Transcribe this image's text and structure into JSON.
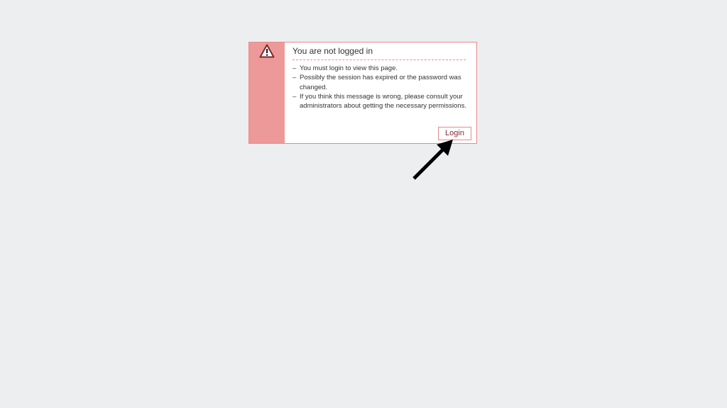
{
  "message": {
    "title": "You are not logged in",
    "items": [
      "You must login to view this page.",
      "Possibly the session has expired or the password was changed.",
      "If you think this message is wrong, please consult your administrators about getting the necessary permissions."
    ],
    "bullet": "–",
    "login_label": "Login",
    "icon": "warning-icon"
  },
  "colors": {
    "background": "#edeef0",
    "sidebar": "#ee9999",
    "border": "#e8898a",
    "button_text": "#8a2a2e",
    "arrow": "#000000"
  }
}
